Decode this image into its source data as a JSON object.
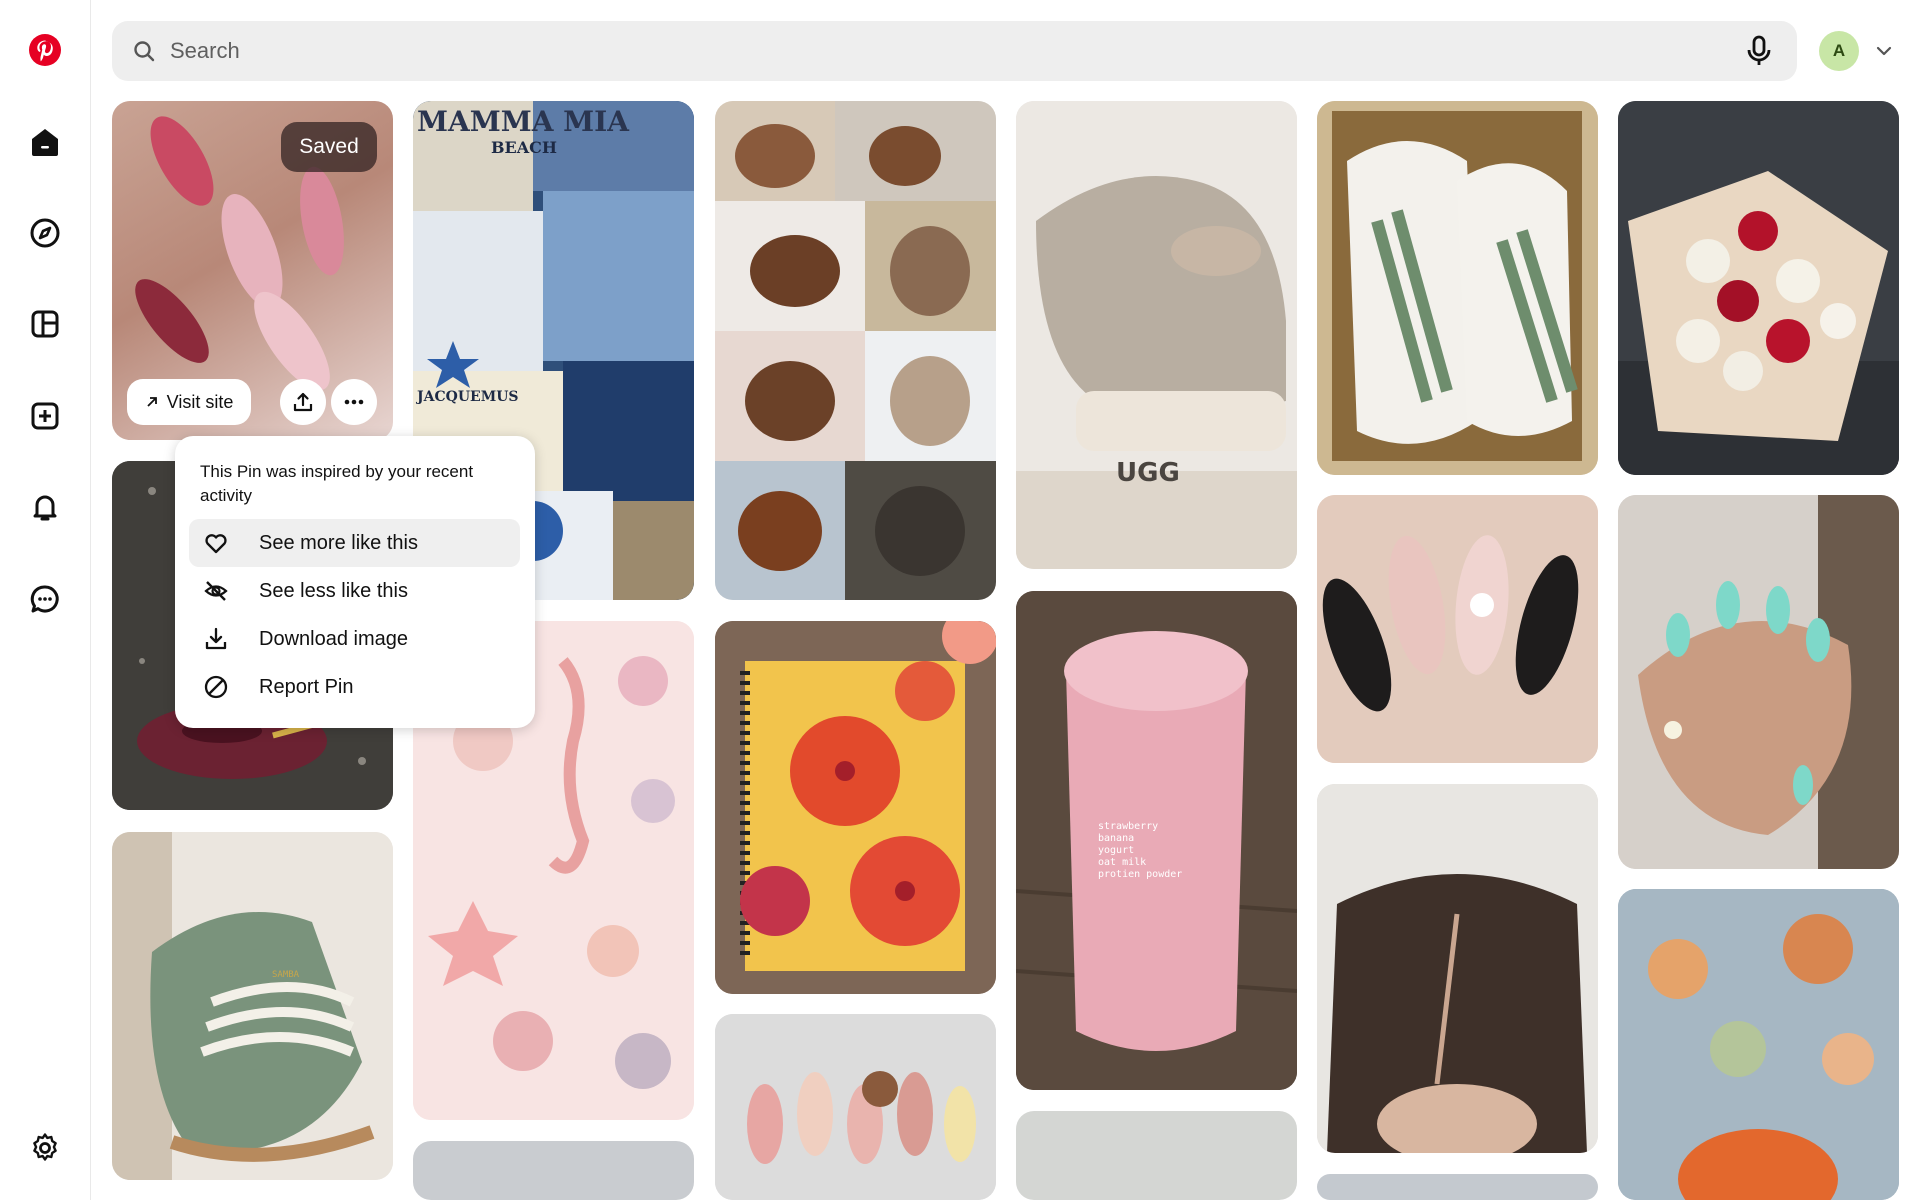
{
  "sidebar": {
    "items": [
      {
        "name": "pinterest-logo",
        "icon": "pinterest-logo-icon"
      },
      {
        "name": "home",
        "icon": "home-icon"
      },
      {
        "name": "explore",
        "icon": "compass-icon"
      },
      {
        "name": "boards",
        "icon": "boards-icon"
      },
      {
        "name": "create",
        "icon": "plus-square-icon"
      },
      {
        "name": "notifications",
        "icon": "bell-icon"
      },
      {
        "name": "messages",
        "icon": "chat-icon"
      },
      {
        "name": "settings",
        "icon": "gear-icon"
      }
    ]
  },
  "header": {
    "search_placeholder": "Search",
    "avatar_initial": "A"
  },
  "pin_overlay": {
    "saved_label": "Saved",
    "visit_site_label": "Visit site"
  },
  "popover": {
    "info_text": "This Pin was inspired by your recent activity",
    "items": [
      {
        "label": "See more like this",
        "icon": "heart-icon"
      },
      {
        "label": "See less like this",
        "icon": "eye-off-icon"
      },
      {
        "label": "Download image",
        "icon": "download-icon"
      },
      {
        "label": "Report Pin",
        "icon": "block-icon"
      }
    ]
  },
  "pins": {
    "collage_title": "MAMMA MIA",
    "collage_beach": "BEACH",
    "collage_brand": "JACQUEMUS",
    "smoothie_recipe": [
      "strawberry",
      "banana",
      "yogurt",
      "oat milk",
      "protien powder"
    ],
    "ugg_logo": "UGG",
    "shoe_logo": "SAMBA"
  },
  "colors": {
    "brand_red": "#e60023",
    "search_bg": "#eeeeee",
    "avatar_bg": "#c8e6a6"
  }
}
